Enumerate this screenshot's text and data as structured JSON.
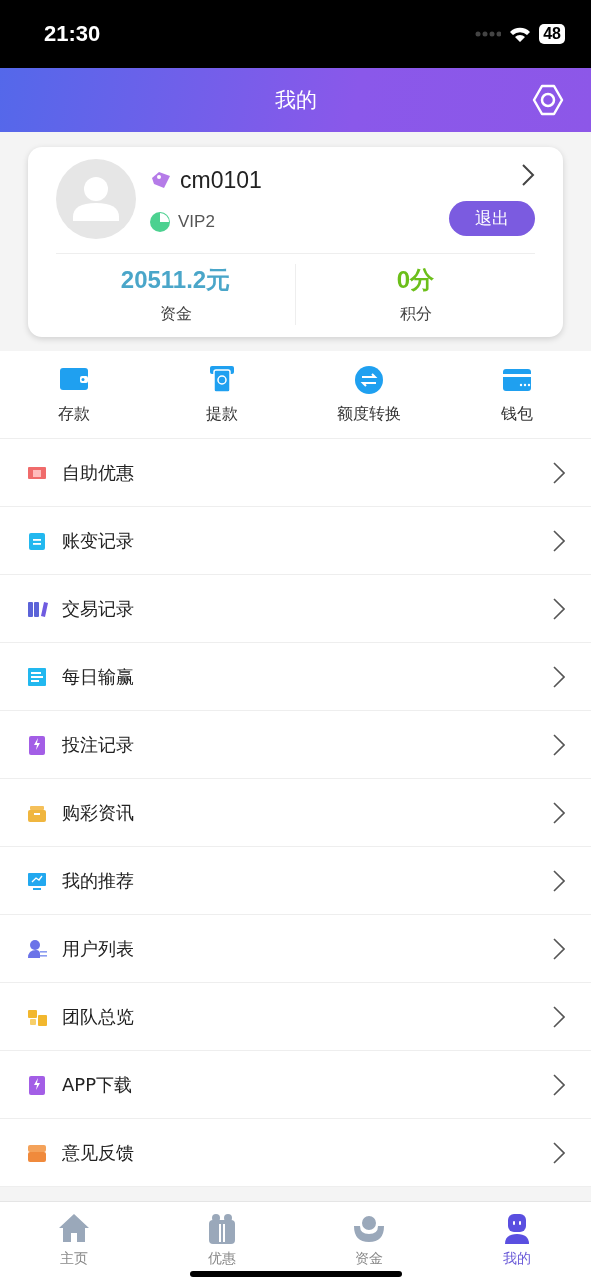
{
  "status_bar": {
    "time": "21:30",
    "battery": "48"
  },
  "header": {
    "title": "我的"
  },
  "profile": {
    "username": "cm0101",
    "vip": "VIP2",
    "logout": "退出",
    "balance": {
      "value": "20511.2元",
      "label": "资金"
    },
    "points": {
      "value": "0分",
      "label": "积分"
    }
  },
  "actions": [
    {
      "label": "存款"
    },
    {
      "label": "提款"
    },
    {
      "label": "额度转换"
    },
    {
      "label": "钱包"
    }
  ],
  "menu": [
    {
      "label": "自助优惠"
    },
    {
      "label": "账变记录"
    },
    {
      "label": "交易记录"
    },
    {
      "label": "每日输赢"
    },
    {
      "label": "投注记录"
    },
    {
      "label": "购彩资讯"
    },
    {
      "label": "我的推荐"
    },
    {
      "label": "用户列表"
    },
    {
      "label": "团队总览"
    },
    {
      "label": "APP下载"
    },
    {
      "label": "意见反馈"
    }
  ],
  "tabbar": [
    {
      "label": "主页",
      "selected": false
    },
    {
      "label": "优惠",
      "selected": false
    },
    {
      "label": "资金",
      "selected": false
    },
    {
      "label": "我的",
      "selected": true
    }
  ]
}
